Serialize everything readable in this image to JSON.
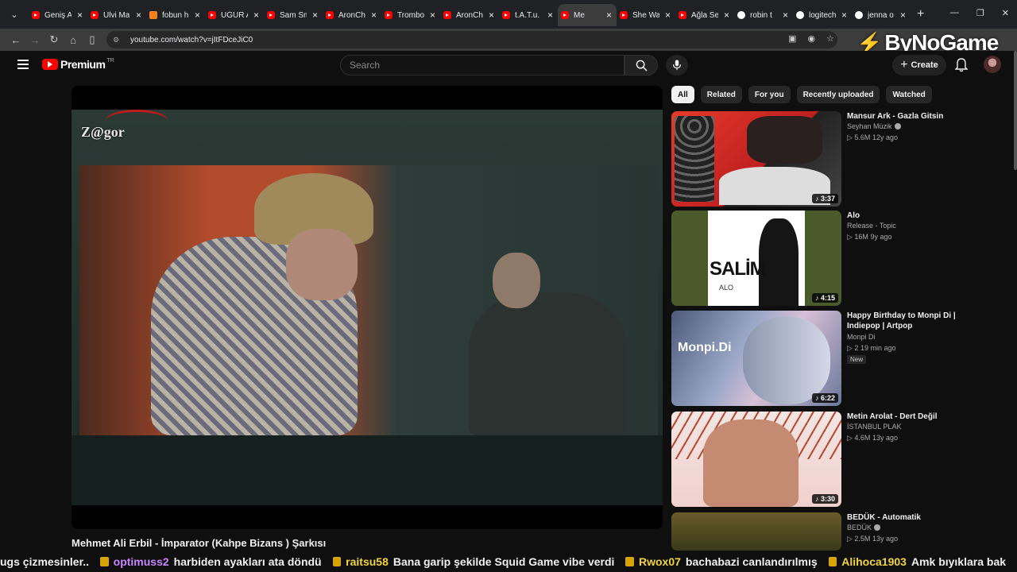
{
  "browser": {
    "tabs": [
      {
        "title": "Geniş A",
        "icon": "youtube-icon",
        "active": false
      },
      {
        "title": "Ulvi Ma",
        "icon": "youtube-icon",
        "active": false
      },
      {
        "title": "fobun h",
        "icon": "hb-icon",
        "active": false
      },
      {
        "title": "UĞUR A",
        "icon": "youtube-icon",
        "active": false
      },
      {
        "title": "Sam Sm",
        "icon": "youtube-icon",
        "active": false
      },
      {
        "title": "AronCh",
        "icon": "youtube-icon",
        "active": false
      },
      {
        "title": "Trombo",
        "icon": "youtube-icon",
        "active": false
      },
      {
        "title": "AronCh",
        "icon": "youtube-icon",
        "active": false
      },
      {
        "title": "t.A.T.u.",
        "icon": "youtube-icon",
        "active": false
      },
      {
        "title": "Me",
        "icon": "youtube-icon",
        "active": true
      },
      {
        "title": "She Wa",
        "icon": "youtube-icon",
        "active": false
      },
      {
        "title": "Ağla Se",
        "icon": "youtube-icon",
        "active": false
      },
      {
        "title": "robin t",
        "icon": "google-icon",
        "active": false
      },
      {
        "title": "logitech",
        "icon": "google-icon",
        "active": false
      },
      {
        "title": "jenna o",
        "icon": "google-icon",
        "active": false
      }
    ],
    "url": "youtube.com/watch?v=jItFDceJiC0"
  },
  "overlay": {
    "logo_text": "ByNoGame"
  },
  "youtube": {
    "brand": "Premium",
    "region": "TR",
    "search_placeholder": "Search",
    "create_label": "Create",
    "video_title": "Mehmet Ali Erbil - İmparator (Kahpe Bizans ) Şarkısı",
    "watermark": "Z@gor",
    "chips": [
      "All",
      "Related",
      "For you",
      "Recently uploaded",
      "Watched"
    ],
    "recommendations": [
      {
        "title": "Mansur Ark - Gazla Gitsin",
        "channel": "Seyhan Müzik",
        "verified": true,
        "views": "5.6M",
        "age": "12y ago",
        "duration": "3:37",
        "badge": ""
      },
      {
        "title": "Alo",
        "channel": "Release - Topic",
        "verified": false,
        "views": "16M",
        "age": "9y ago",
        "duration": "4:15",
        "badge": "",
        "thumb_text": "SALİM",
        "thumb_sub": "ALO"
      },
      {
        "title": "Happy Birthday to Monpi Di | Indiepop | Artpop",
        "channel": "Monpi Di",
        "verified": false,
        "views": "2",
        "age": "19 min ago",
        "duration": "6:22",
        "badge": "New",
        "thumb_text": "Monpi.Di"
      },
      {
        "title": "Metin Arolat - Dert Değil",
        "channel": "İSTANBUL PLAK",
        "verified": false,
        "views": "4.6M",
        "age": "13y ago",
        "duration": "3:30",
        "badge": ""
      },
      {
        "title": "BEDÜK - Automatik",
        "channel": "BEDÜK",
        "verified": true,
        "views": "2.5M",
        "age": "13y ago",
        "duration": "",
        "badge": ""
      }
    ]
  },
  "chat_ticker": [
    {
      "user": "",
      "message": "ugs çizmesinler.."
    },
    {
      "user": "optimuss2",
      "message": "harbiden ayakları ata döndü"
    },
    {
      "user": "raitsu58",
      "message": "Bana garip şekilde Squid Game vibe verdi"
    },
    {
      "user": "Rwox07",
      "message": "bachabazi canlandırılmış"
    },
    {
      "user": "Alihoca1903",
      "message": "Amk bıyıklara bak"
    }
  ]
}
